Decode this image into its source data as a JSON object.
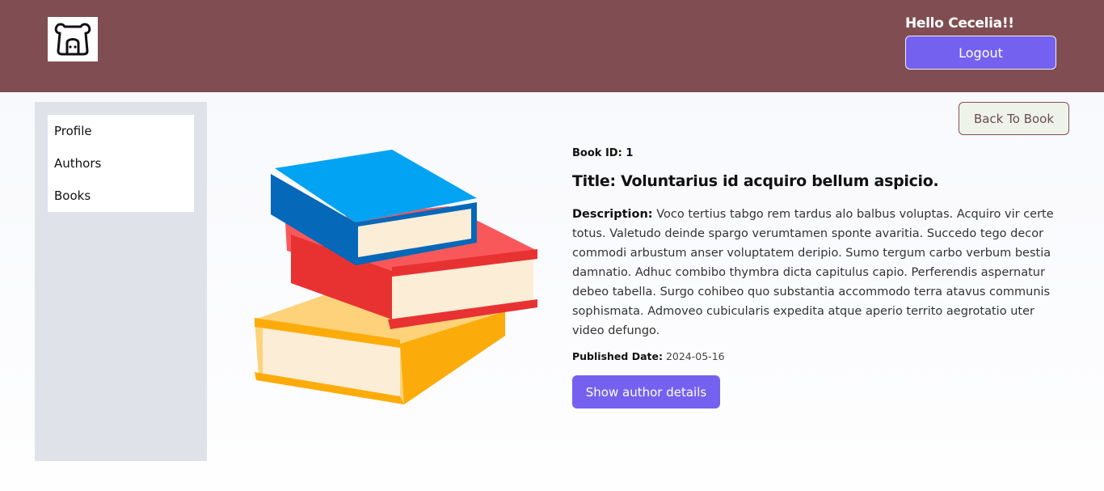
{
  "header": {
    "logo_icon": "bear-face-icon",
    "greeting": "Hello Cecelia!!",
    "logout_label": "Logout",
    "background_color": "#804e52",
    "accent_color": "#7561ef"
  },
  "sidebar": {
    "items": [
      {
        "label": "Profile"
      },
      {
        "label": "Authors"
      },
      {
        "label": "Books"
      }
    ]
  },
  "main": {
    "back_label": "Back To Book",
    "book_image_icon": "stack-of-books-icon",
    "book_id_label": "Book ID:",
    "book_id": "1",
    "title_label": "Title:",
    "title": "Voluntarius id acquiro bellum aspicio.",
    "description_label": "Description:",
    "description": "Voco tertius tabgo rem tardus alo balbus voluptas. Acquiro vir certe totus. Valetudo deinde spargo verumtamen sponte avaritia. Succedo tego decor commodi arbustum anser voluptatem deripio. Sumo tergum carbo verbum bestia damnatio. Adhuc combibo thymbra dicta capitulus capio. Perferendis aspernatur debeo tabella. Surgo cohibeo quo substantia accommodo terra atavus communis sophismata. Admoveo cubicularis expedita atque aperio territo aegrotatio uter video defungo.",
    "published_label": "Published Date:",
    "published_date": "2024-05-16",
    "author_button_label": "Show author details"
  }
}
